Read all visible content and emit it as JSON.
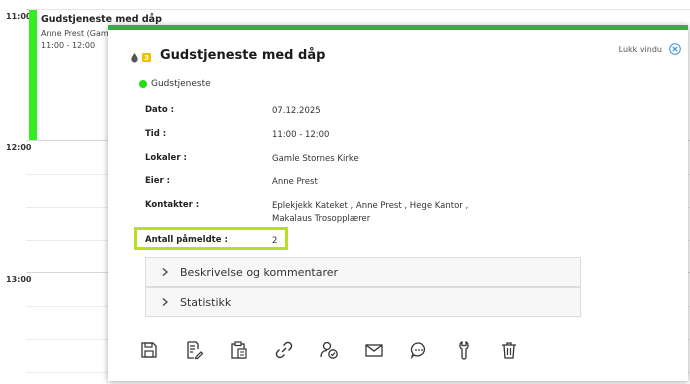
{
  "calendar": {
    "hours": [
      "11:00",
      "12:00",
      "13:00"
    ],
    "event": {
      "title": "Gudstjeneste med dåp",
      "person": "Anne Prest (Gam",
      "time": "11:00 - 12:00",
      "color": "#33ee22"
    }
  },
  "popup": {
    "accent_color": "#2fb04a",
    "badge_text": "3",
    "title": "Gudstjeneste med dåp",
    "close_label": "Lukk vindu",
    "category": {
      "label": "Gudstjeneste",
      "color": "#22dd11"
    },
    "fields": {
      "dato": {
        "label": "Dato :",
        "value": "07.12.2025"
      },
      "tid": {
        "label": "Tid :",
        "value": "11:00 - 12:00"
      },
      "lokaler": {
        "label": "Lokaler :",
        "value": "Gamle Stornes Kirke"
      },
      "eier": {
        "label": "Eier :",
        "value": "Anne Prest"
      },
      "kontakter": {
        "label": "Kontakter :",
        "line1": "Eplekjekk Kateket ,  Anne Prest ,  Hege Kantor ,",
        "line2": "Makalaus Trosopplærer"
      },
      "pameldte": {
        "label": "Antall påmeldte :",
        "value": "2"
      }
    },
    "highlight_color": "#b8e020",
    "sections": {
      "description": "Beskrivelse og kommentarer",
      "statistics": "Statistikk"
    },
    "toolbar_icons": [
      "save-icon",
      "edit-icon",
      "clipboard-icon",
      "link-icon",
      "user-check-icon",
      "mail-icon",
      "chat-icon",
      "wrench-icon",
      "trash-icon"
    ]
  }
}
